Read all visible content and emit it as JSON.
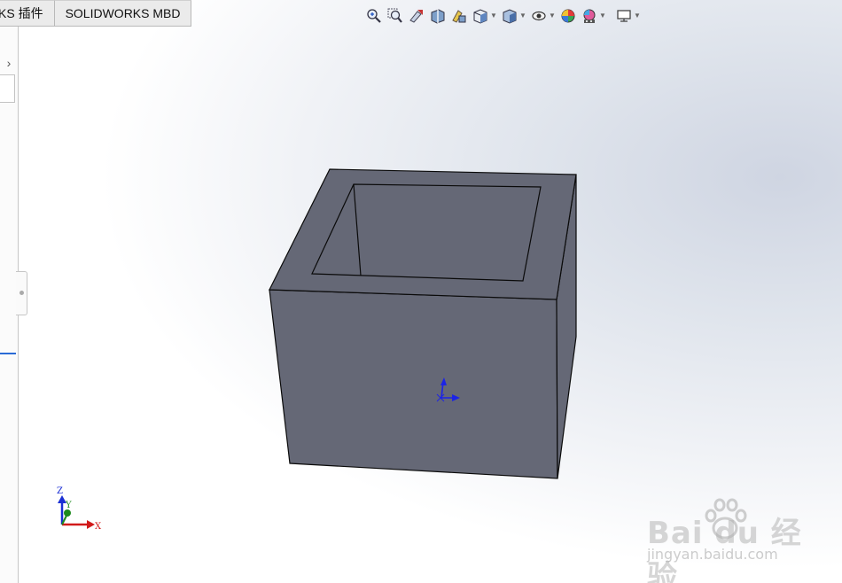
{
  "tabs": [
    {
      "label": "KS 插件"
    },
    {
      "label": "SOLIDWORKS MBD"
    }
  ],
  "left_panel": {
    "expand_arrow": "›"
  },
  "hud_toolbar": {
    "icons": [
      "zoom-to-fit-icon",
      "zoom-to-area-icon",
      "previous-view-icon",
      "section-view-icon",
      "dynamic-annotation-view-icon",
      "view-orientation-icon",
      "display-style-icon",
      "hide-show-items-icon",
      "edit-appearance-icon",
      "apply-scene-icon",
      "view-settings-icon"
    ]
  },
  "triad": {
    "x_label": "X",
    "y_label": "Y",
    "z_label": "Z"
  },
  "watermark": {
    "brand": "Bai  du 经验",
    "url": "jingyan.baidu.com"
  },
  "colors": {
    "part_face": "#656876",
    "part_edge": "#0a0a0a",
    "axis_x": "#d11a1a",
    "axis_y": "#1d8a1d",
    "axis_z": "#1b2fd4",
    "origin": "#1c24e6"
  }
}
